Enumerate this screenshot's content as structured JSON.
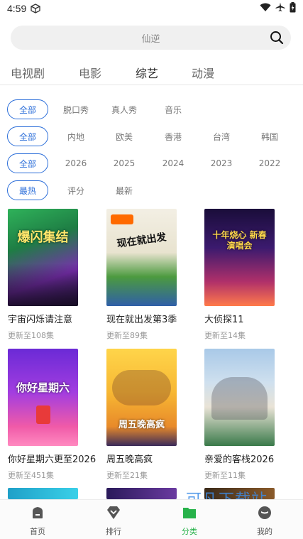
{
  "status_bar": {
    "time": "4:59"
  },
  "search": {
    "text": "仙逆"
  },
  "tabs": [
    {
      "label": "电视剧"
    },
    {
      "label": "电影"
    },
    {
      "label": "综艺"
    },
    {
      "label": "动漫"
    }
  ],
  "filters": {
    "genre": [
      "全部",
      "脱口秀",
      "真人秀",
      "音乐"
    ],
    "region": [
      "全部",
      "内地",
      "欧美",
      "香港",
      "台湾",
      "韩国"
    ],
    "year": [
      "全部",
      "2026",
      "2025",
      "2024",
      "2023",
      "2022"
    ],
    "sort": [
      "最热",
      "评分",
      "最新"
    ]
  },
  "shows": [
    {
      "title": "宇宙闪烁请注意",
      "update": "更新至108集",
      "poster_text": "爆闪集结"
    },
    {
      "title": "现在就出发第3季",
      "update": "更新至89集",
      "poster_text": "现在就出发"
    },
    {
      "title": "大侦探11",
      "update": "更新至14集",
      "poster_text": "十年烧心 新春演唱会"
    },
    {
      "title": "你好星期六更至2026",
      "update": "更新至451集",
      "poster_text": "你好星期六"
    },
    {
      "title": "周五晚高疯",
      "update": "更新至21集",
      "poster_text": "周五晚高疯"
    },
    {
      "title": "亲爱的客栈2026",
      "update": "更新至11集",
      "poster_text": ""
    }
  ],
  "bottom_nav": [
    {
      "label": "首页"
    },
    {
      "label": "排行"
    },
    {
      "label": "分类"
    },
    {
      "label": "我的"
    }
  ],
  "watermark": "可凡下载站",
  "colors": {
    "accent": "#2a6dd9",
    "nav_active": "#27b24a"
  }
}
